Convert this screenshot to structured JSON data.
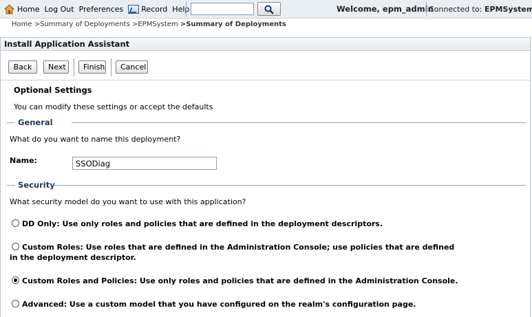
{
  "header": {
    "nav": [
      {
        "label": "Home",
        "icon": "home-icon"
      },
      {
        "label": "Log Out"
      },
      {
        "label": "Preferences"
      },
      {
        "label": "Record",
        "icon": "record-icon"
      },
      {
        "label": "Help"
      }
    ],
    "search": {
      "value": "",
      "button_icon": "search-icon"
    },
    "welcome": "Welcome, epm_admin",
    "connected_label": "Connected to: ",
    "connected_value": "EPMSystem"
  },
  "breadcrumb": {
    "items": [
      "Home",
      ">Summary of Deployments",
      ">EPMSystem",
      ">Summary of Deployments"
    ]
  },
  "panel": {
    "title": "Install Application Assistant",
    "buttons": {
      "back": "Back",
      "next": "Next",
      "finish": "Finish",
      "cancel": "Cancel"
    },
    "heading": "Optional Settings",
    "intro": "You can modify these settings or accept the defaults",
    "general": {
      "legend": "General",
      "question": "What do you want to name this deployment?",
      "name_label": "Name:",
      "name_value": "SSODiag"
    },
    "security": {
      "legend": "Security",
      "question": "What security model do you want to use with this application?",
      "options": [
        {
          "line1": "DD Only: Use only roles and policies that are defined in the deployment descriptors.",
          "line2": "",
          "selected": false
        },
        {
          "line1": "Custom Roles: Use roles that are defined in the Administration Console; use policies that are defined",
          "line2": "in the deployment descriptor.",
          "selected": false
        },
        {
          "line1": "Custom Roles and Policies: Use only roles and policies that are defined in the Administration Console.",
          "line2": "",
          "selected": true
        },
        {
          "line1": "Advanced: Use a custom model that you have configured on the realm's configuration page.",
          "line2": "",
          "selected": false
        }
      ]
    }
  },
  "colors": {
    "topbar_bg": "#e9eef3",
    "section_line": "#8ea6bd",
    "section_label": "#1e3a58"
  }
}
